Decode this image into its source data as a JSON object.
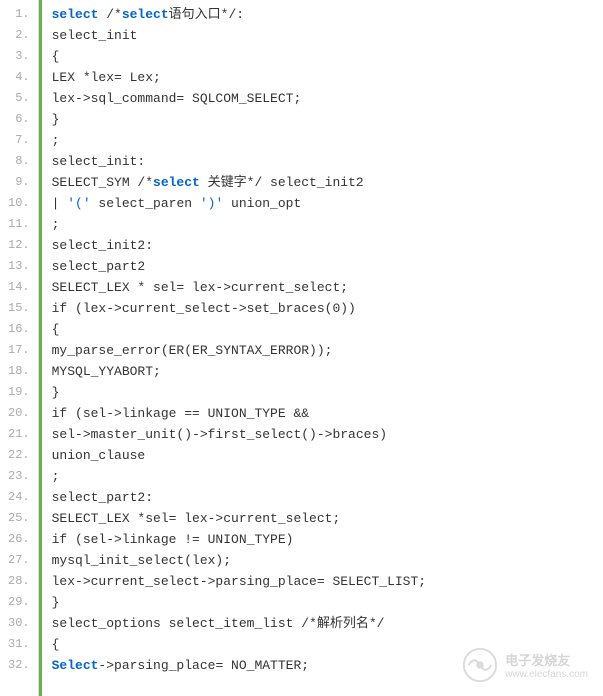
{
  "lines": [
    {
      "num": "1.",
      "segments": [
        {
          "t": "select",
          "c": "kw"
        },
        {
          "t": " /*"
        },
        {
          "t": "select",
          "c": "kw"
        },
        {
          "t": "语句入口*/:"
        }
      ]
    },
    {
      "num": "2.",
      "segments": [
        {
          "t": "select_init"
        }
      ]
    },
    {
      "num": "3.",
      "segments": [
        {
          "t": "{"
        }
      ]
    },
    {
      "num": "4.",
      "segments": [
        {
          "t": "LEX *lex= Lex;"
        }
      ]
    },
    {
      "num": "5.",
      "segments": [
        {
          "t": "lex->sql_command= SQLCOM_SELECT;"
        }
      ]
    },
    {
      "num": "6.",
      "segments": [
        {
          "t": "}"
        }
      ]
    },
    {
      "num": "7.",
      "segments": [
        {
          "t": ";"
        }
      ]
    },
    {
      "num": "8.",
      "segments": [
        {
          "t": "select_init:"
        }
      ]
    },
    {
      "num": "9.",
      "segments": [
        {
          "t": "SELECT_SYM /*"
        },
        {
          "t": "select",
          "c": "kw"
        },
        {
          "t": " 关键字*/ select_init2"
        }
      ]
    },
    {
      "num": "10.",
      "segments": [
        {
          "t": "| "
        },
        {
          "t": "'('",
          "c": "str"
        },
        {
          "t": " select_paren "
        },
        {
          "t": "')'",
          "c": "str"
        },
        {
          "t": " union_opt"
        }
      ]
    },
    {
      "num": "11.",
      "segments": [
        {
          "t": ";"
        }
      ]
    },
    {
      "num": "12.",
      "segments": [
        {
          "t": "select_init2:"
        }
      ]
    },
    {
      "num": "13.",
      "segments": [
        {
          "t": "select_part2"
        }
      ]
    },
    {
      "num": "14.",
      "segments": [
        {
          "t": "SELECT_LEX * sel= lex->current_select;"
        }
      ]
    },
    {
      "num": "15.",
      "segments": [
        {
          "t": "if (lex->current_select->set_braces(0))"
        }
      ]
    },
    {
      "num": "16.",
      "segments": [
        {
          "t": "{"
        }
      ]
    },
    {
      "num": "17.",
      "segments": [
        {
          "t": "my_parse_error(ER(ER_SYNTAX_ERROR));"
        }
      ]
    },
    {
      "num": "18.",
      "segments": [
        {
          "t": "MYSQL_YYABORT;"
        }
      ]
    },
    {
      "num": "19.",
      "segments": [
        {
          "t": "}"
        }
      ]
    },
    {
      "num": "20.",
      "segments": [
        {
          "t": "if (sel->linkage == UNION_TYPE &&"
        }
      ]
    },
    {
      "num": "21.",
      "segments": [
        {
          "t": "sel->master_unit()->first_select()->braces)"
        }
      ]
    },
    {
      "num": "22.",
      "segments": [
        {
          "t": "union_clause"
        }
      ]
    },
    {
      "num": "23.",
      "segments": [
        {
          "t": ";"
        }
      ]
    },
    {
      "num": "24.",
      "segments": [
        {
          "t": "select_part2:"
        }
      ]
    },
    {
      "num": "25.",
      "segments": [
        {
          "t": "SELECT_LEX *sel= lex->current_select;"
        }
      ]
    },
    {
      "num": "26.",
      "segments": [
        {
          "t": "if (sel->linkage != UNION_TYPE)"
        }
      ]
    },
    {
      "num": "27.",
      "segments": [
        {
          "t": "mysql_init_select(lex);"
        }
      ]
    },
    {
      "num": "28.",
      "segments": [
        {
          "t": "lex->current_select->parsing_place= SELECT_LIST;"
        }
      ]
    },
    {
      "num": "29.",
      "segments": [
        {
          "t": "}"
        }
      ]
    },
    {
      "num": "30.",
      "segments": [
        {
          "t": "select_options select_item_list /*解析列名*/"
        }
      ]
    },
    {
      "num": "31.",
      "segments": [
        {
          "t": "{"
        }
      ]
    },
    {
      "num": "32.",
      "segments": [
        {
          "t": "Select",
          "c": "kw"
        },
        {
          "t": "->parsing_place= NO_MATTER;"
        }
      ]
    }
  ],
  "watermark": {
    "cn": "电子发烧友",
    "url": "www.elecfans.com"
  }
}
